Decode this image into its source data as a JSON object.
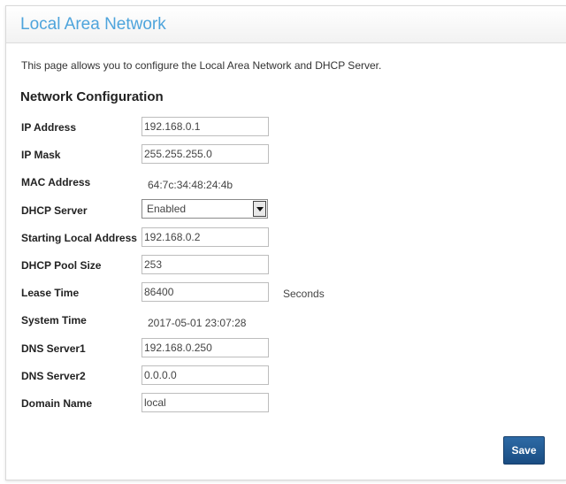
{
  "page": {
    "title": "Local Area Network",
    "intro": "This page allows you to configure the Local Area Network and DHCP Server.",
    "section_title": "Network Configuration"
  },
  "form": {
    "ip_address": {
      "label": "IP Address",
      "value": "192.168.0.1"
    },
    "ip_mask": {
      "label": "IP Mask",
      "value": "255.255.255.0"
    },
    "mac_address": {
      "label": "MAC Address",
      "value": "64:7c:34:48:24:4b"
    },
    "dhcp_server": {
      "label": "DHCP Server",
      "value": "Enabled"
    },
    "starting_local_address": {
      "label": "Starting Local Address",
      "value": "192.168.0.2"
    },
    "dhcp_pool_size": {
      "label": "DHCP Pool Size",
      "value": "253"
    },
    "lease_time": {
      "label": "Lease Time",
      "value": "86400",
      "unit": "Seconds"
    },
    "system_time": {
      "label": "System Time",
      "value": "2017-05-01 23:07:28"
    },
    "dns_server1": {
      "label": "DNS Server1",
      "value": "192.168.0.250"
    },
    "dns_server2": {
      "label": "DNS Server2",
      "value": "0.0.0.0"
    },
    "domain_name": {
      "label": "Domain Name",
      "value": "local"
    }
  },
  "actions": {
    "save_label": "Save"
  },
  "colors": {
    "title": "#4ea4dc",
    "save_button": "#1f5a93"
  }
}
